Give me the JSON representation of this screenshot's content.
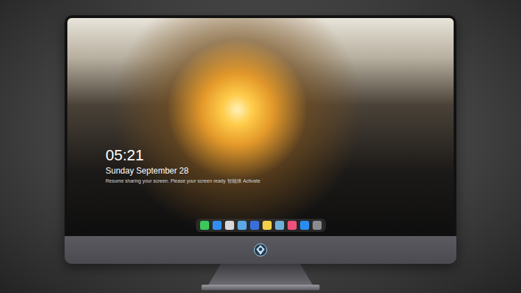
{
  "lockscreen": {
    "time": "05:21",
    "date": "Sunday September 28",
    "notice": "Resume sharing your screen. Please your screen ready 智能体 Activate"
  },
  "dock": {
    "apps": [
      {
        "color": "#3cc85a"
      },
      {
        "color": "#2f8ef0"
      },
      {
        "color": "#d8d8dc"
      },
      {
        "color": "#5aa8e8"
      },
      {
        "color": "#3a6fd8"
      },
      {
        "color": "#f5d04a"
      },
      {
        "color": "#6fb0d8"
      },
      {
        "color": "#f0507a"
      },
      {
        "color": "#2a8cf0"
      },
      {
        "color": "#8a8a90"
      }
    ]
  }
}
